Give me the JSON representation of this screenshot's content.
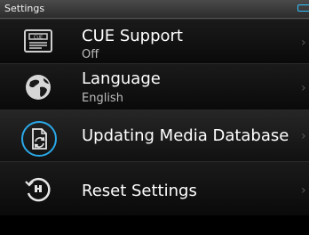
{
  "statusbar": {
    "title": "Settings",
    "battery_color": "#35c3ff"
  },
  "items": [
    {
      "icon": "cue-sheet-icon",
      "label": "CUE Support",
      "value": "Off"
    },
    {
      "icon": "globe-icon",
      "label": "Language",
      "value": "English"
    },
    {
      "icon": "update-database-icon",
      "label": "Updating Media Database"
    },
    {
      "icon": "reset-icon",
      "label": "Reset Settings"
    }
  ]
}
